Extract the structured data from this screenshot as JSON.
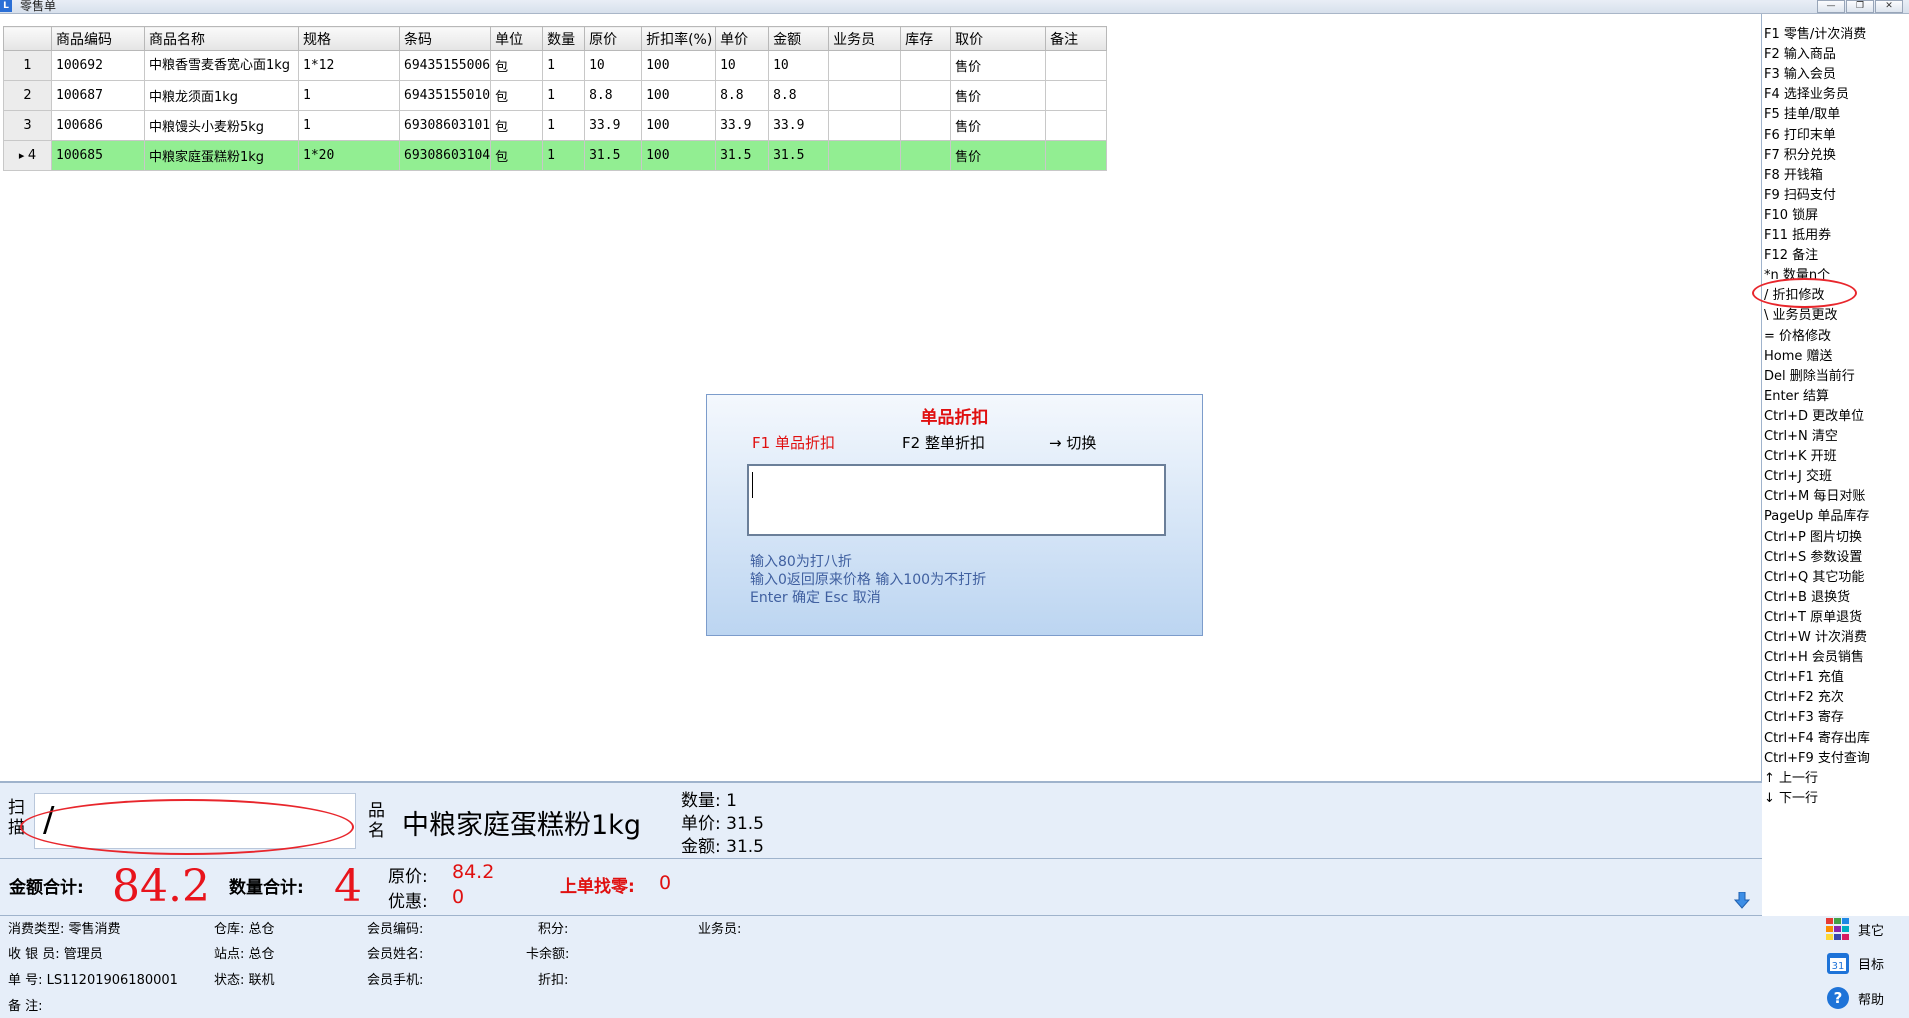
{
  "window": {
    "title": "零售单"
  },
  "grid": {
    "headers": [
      "",
      "商品编码",
      "商品名称",
      "规格",
      "条码",
      "单位",
      "数量",
      "原价",
      "折扣率(%)",
      "单价",
      "金额",
      "业务员",
      "库存",
      "取价",
      "备注"
    ],
    "rows": [
      {
        "no": "1",
        "code": "100692",
        "name": "中粮香雪麦香宽心面1kg",
        "spec": "1*12",
        "barcode": "69435155006",
        "unit": "包",
        "qty": "1",
        "orig": "10",
        "disc": "100",
        "price": "10",
        "amount": "10",
        "salesman": "",
        "stock": "",
        "pricing": "售价",
        "note": ""
      },
      {
        "no": "2",
        "code": "100687",
        "name": "中粮龙须面1kg",
        "spec": "1",
        "barcode": "69435155010",
        "unit": "包",
        "qty": "1",
        "orig": "8.8",
        "disc": "100",
        "price": "8.8",
        "amount": "8.8",
        "salesman": "",
        "stock": "",
        "pricing": "售价",
        "note": ""
      },
      {
        "no": "3",
        "code": "100686",
        "name": "中粮馒头小麦粉5kg",
        "spec": "1",
        "barcode": "69308603101",
        "unit": "包",
        "qty": "1",
        "orig": "33.9",
        "disc": "100",
        "price": "33.9",
        "amount": "33.9",
        "salesman": "",
        "stock": "",
        "pricing": "售价",
        "note": ""
      },
      {
        "no": "4",
        "code": "100685",
        "name": "中粮家庭蛋糕粉1kg",
        "spec": "1*20",
        "barcode": "69308603104",
        "unit": "包",
        "qty": "1",
        "orig": "31.5",
        "disc": "100",
        "price": "31.5",
        "amount": "31.5",
        "salesman": "",
        "stock": "",
        "pricing": "售价",
        "note": ""
      }
    ],
    "selected_row": 4
  },
  "dialog": {
    "title": "单品折扣",
    "tab1": "F1 单品折扣",
    "tab2": "F2 整单折扣",
    "tab3": "→ 切换",
    "input_value": "",
    "hint1": "输入80为打八折",
    "hint2": "输入0返回原来价格  输入100为不打折",
    "hint3": "Enter 确定   Esc 取消"
  },
  "shortcuts": [
    "F1 零售/计次消费",
    "F2 输入商品",
    "F3 输入会员",
    "F4 选择业务员",
    "F5 挂单/取单",
    "F6 打印末单",
    "F7 积分兑换",
    "F8 开钱箱",
    "F9 扫码支付",
    "F10 锁屏",
    "F11 抵用券",
    "F12 备注",
    "*n 数量n个",
    "/ 折扣修改",
    "\\ 业务员更改",
    "= 价格修改",
    "Home 赠送",
    "Del 删除当前行",
    "Enter 结算",
    "Ctrl+D 更改单位",
    "Ctrl+N 清空",
    "Ctrl+K 开班",
    "Ctrl+J 交班",
    "Ctrl+M 每日对账",
    "PageUp 单品库存",
    "Ctrl+P 图片切换",
    "Ctrl+S 参数设置",
    "Ctrl+Q 其它功能",
    "Ctrl+B 退换货",
    "Ctrl+T 原单退货",
    "Ctrl+W 计次消费",
    "Ctrl+H 会员销售",
    "Ctrl+F1 充值",
    "Ctrl+F2 充次",
    "Ctrl+F3 寄存",
    "Ctrl+F4 寄存出库",
    "Ctrl+F9 支付查询",
    "↑ 上一行",
    "↓ 下一行"
  ],
  "scan": {
    "label": "扫描",
    "input_value": "/",
    "pin_label": "品名",
    "product_name": "中粮家庭蛋糕粉1kg",
    "qty_line": "数量: 1",
    "price_line": "单价: 31.5",
    "amount_line": "金额: 31.5"
  },
  "totals": {
    "amount_label": "金额合计:",
    "amount_value": "84.2",
    "qty_label": "数量合计:",
    "qty_value": "4",
    "orig_label": "原价:",
    "orig_value": "84.2",
    "discount_label": "优惠:",
    "discount_value": "0",
    "change_label": "上单找零:",
    "change_value": "0"
  },
  "status": {
    "type": "消费类型: 零售消费",
    "cashier": "收 银 员: 管理员",
    "order_no": "单    号: LS11201906180001",
    "note": "备    注:",
    "warehouse": "仓库: 总仓",
    "station": "站点: 总仓",
    "state": "状态: 联机",
    "member_code": "会员编码:",
    "member_name": "会员姓名:",
    "member_phone": "会员手机:",
    "points": "积分:",
    "card_balance": "卡余额:",
    "discount": "折扣:",
    "salesman": "业务员:"
  },
  "side_buttons": {
    "other": "其它",
    "target": "目标",
    "help": "帮助"
  },
  "colors": {
    "accent_red": "#e8141c",
    "selected_row": "#92ee92",
    "panel_blue": "#e6eef9"
  }
}
